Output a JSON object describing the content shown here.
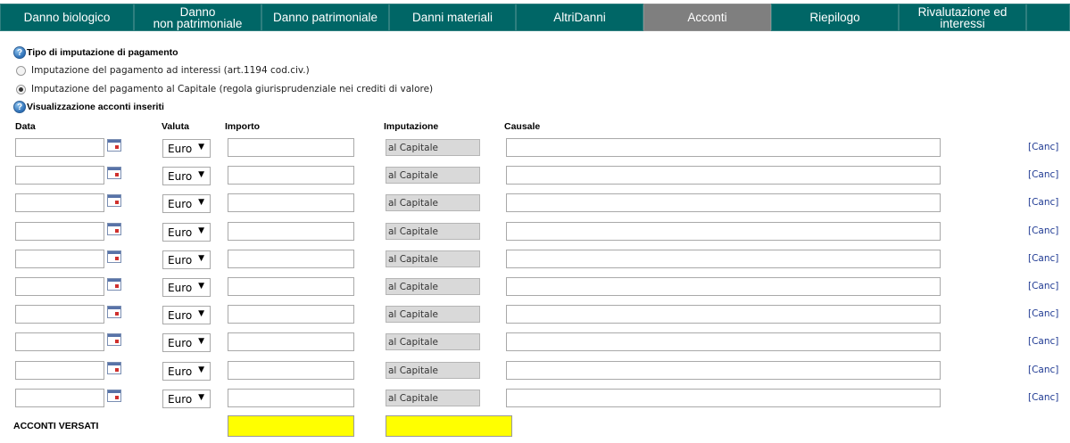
{
  "tabs": [
    {
      "label": "Danno biologico",
      "active": false
    },
    {
      "label": "Danno\nnon patrimoniale",
      "active": false
    },
    {
      "label": "Danno patrimoniale",
      "active": false
    },
    {
      "label": "Danni materiali",
      "active": false
    },
    {
      "label": "AltriDanni",
      "active": false
    },
    {
      "label": "Acconti",
      "active": true
    },
    {
      "label": "Riepilogo",
      "active": false
    },
    {
      "label": "Rivalutazione ed\ninteressi",
      "active": false
    }
  ],
  "imputation_section": {
    "title": "Tipo di imputazione di pagamento",
    "options": [
      {
        "label": "Imputazione del pagamento ad interessi (art.1194 cod.civ.)",
        "checked": false
      },
      {
        "label": "Imputazione del pagamento al Capitale (regola giurisprudenziale nei crediti di valore)",
        "checked": true
      }
    ]
  },
  "acconti_section": {
    "title": "Visualizzazione acconti inseriti",
    "columns": {
      "data": "Data",
      "valuta": "Valuta",
      "importo": "Importo",
      "imputazione": "Imputazione",
      "causale": "Causale"
    },
    "rows": [
      {
        "data": "",
        "valuta": "Euro",
        "importo": "",
        "imputazione": "al Capitale",
        "causale": "",
        "action": "[Canc]"
      },
      {
        "data": "",
        "valuta": "Euro",
        "importo": "",
        "imputazione": "al Capitale",
        "causale": "",
        "action": "[Canc]"
      },
      {
        "data": "",
        "valuta": "Euro",
        "importo": "",
        "imputazione": "al Capitale",
        "causale": "",
        "action": "[Canc]"
      },
      {
        "data": "",
        "valuta": "Euro",
        "importo": "",
        "imputazione": "al Capitale",
        "causale": "",
        "action": "[Canc]"
      },
      {
        "data": "",
        "valuta": "Euro",
        "importo": "",
        "imputazione": "al Capitale",
        "causale": "",
        "action": "[Canc]"
      },
      {
        "data": "",
        "valuta": "Euro",
        "importo": "",
        "imputazione": "al Capitale",
        "causale": "",
        "action": "[Canc]"
      },
      {
        "data": "",
        "valuta": "Euro",
        "importo": "",
        "imputazione": "al Capitale",
        "causale": "",
        "action": "[Canc]"
      },
      {
        "data": "",
        "valuta": "Euro",
        "importo": "",
        "imputazione": "al Capitale",
        "causale": "",
        "action": "[Canc]"
      },
      {
        "data": "",
        "valuta": "Euro",
        "importo": "",
        "imputazione": "al Capitale",
        "causale": "",
        "action": "[Canc]"
      },
      {
        "data": "",
        "valuta": "Euro",
        "importo": "",
        "imputazione": "al Capitale",
        "causale": "",
        "action": "[Canc]"
      }
    ],
    "totals": {
      "label": "ACCONTI VERSATI",
      "importo_total": "",
      "imputazione_total": ""
    }
  },
  "colors": {
    "tab_bg": "#006666",
    "tab_active_bg": "#7f7f7f",
    "total_highlight": "#ffff00",
    "link": "#1f3a93",
    "readonly_bg": "#d9d9d9"
  },
  "icons": {
    "help": "help-icon",
    "calendar": "calendar-icon",
    "dropdown": "dropdown-arrow-icon"
  }
}
